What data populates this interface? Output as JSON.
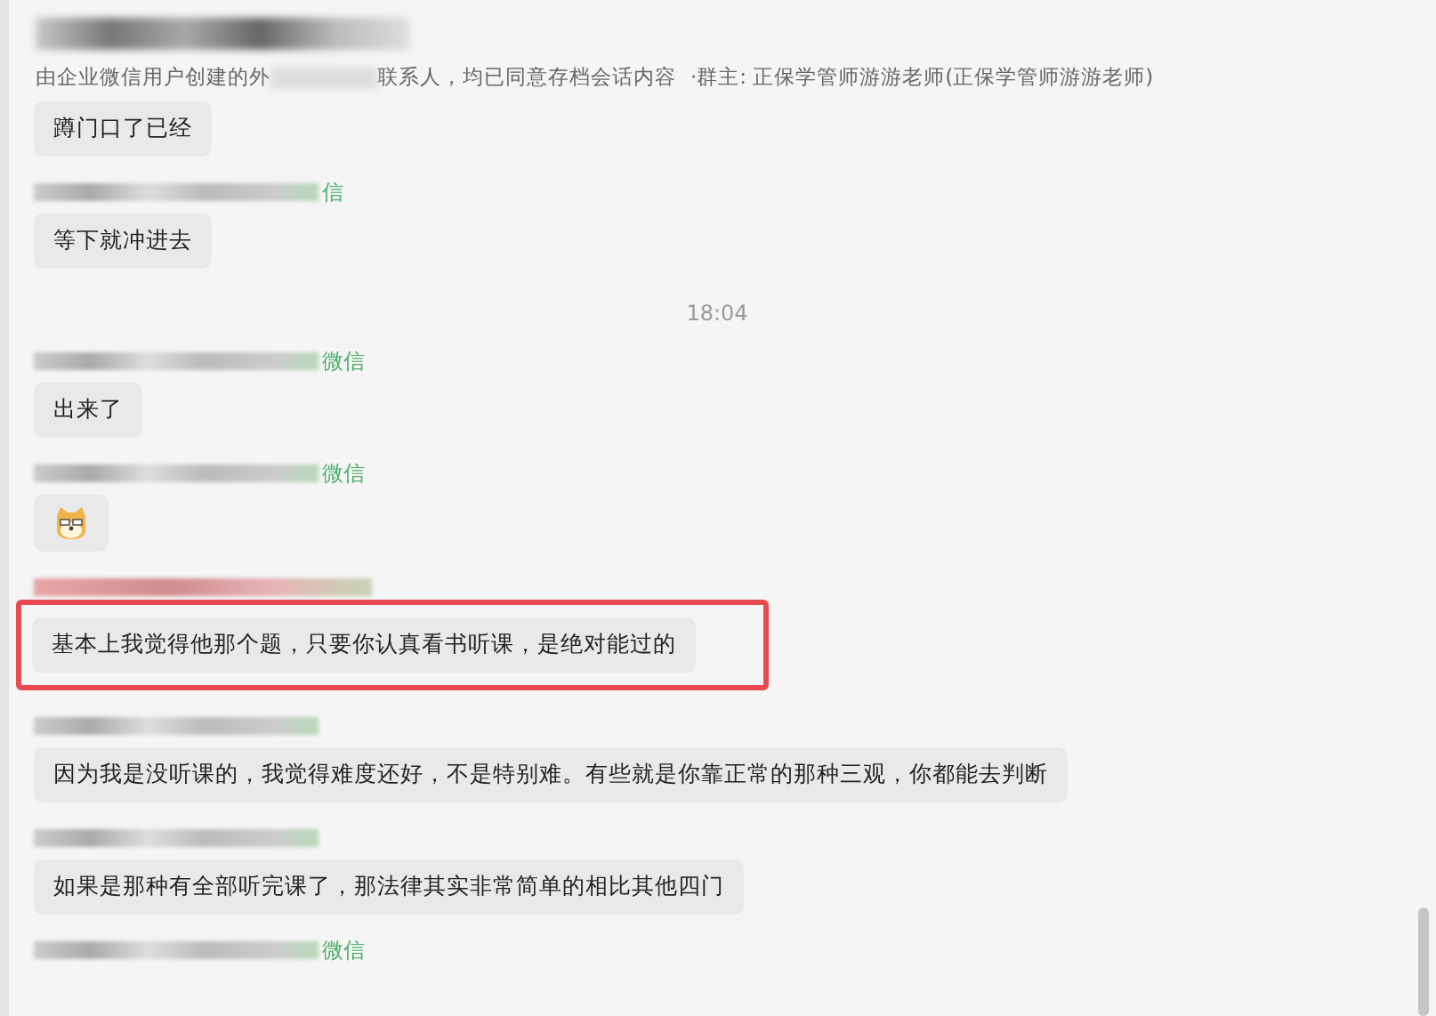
{
  "header": {
    "subtitle_start": "由企业微信用户创建的外",
    "subtitle_end": "联系人，均已同意存档会话内容",
    "owner": "·群主: 正保学管师游游老师(正保学管师游游老师)"
  },
  "messages": [
    {
      "kind": "continued_text",
      "text": "蹲门口了已经",
      "highlighted": false
    },
    {
      "kind": "text",
      "source": "信",
      "text": "等下就冲进去",
      "highlighted": false
    },
    {
      "kind": "time",
      "text": "18:04"
    },
    {
      "kind": "text",
      "source": "微信",
      "text": "出来了",
      "highlighted": false
    },
    {
      "kind": "sticker",
      "source": "微信"
    },
    {
      "kind": "text",
      "text": "基本上我觉得他那个题，只要你认真看书听课，是绝对能过的",
      "highlighted": true
    },
    {
      "kind": "text",
      "text": "因为我是没听课的，我觉得难度还好，不是特别难。有些就是你靠正常的那种三观，你都能去判断",
      "highlighted": false
    },
    {
      "kind": "text",
      "text": "如果是那种有全部听完课了，那法律其实非常简单的相比其他四门",
      "highlighted": false
    },
    {
      "kind": "sender_only",
      "source": "微信"
    }
  ]
}
